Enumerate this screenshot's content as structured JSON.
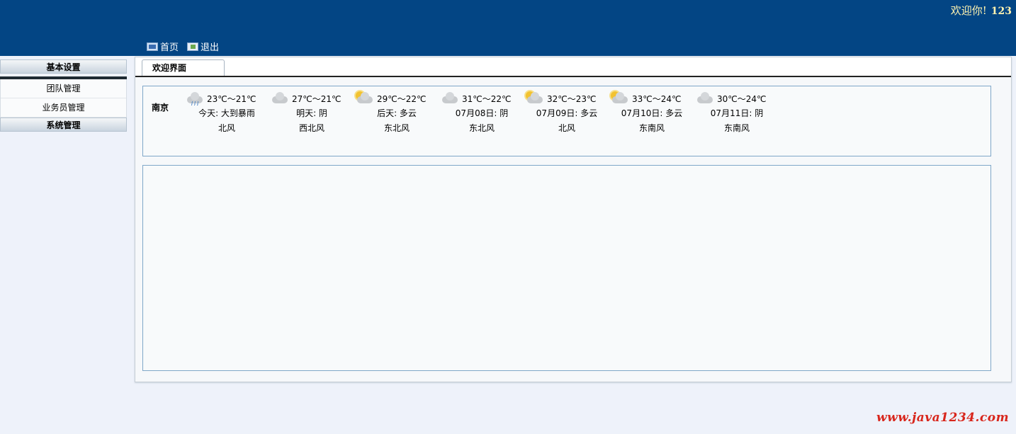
{
  "header": {
    "welcome_text": "欢迎你!",
    "username": "123",
    "nav": [
      {
        "label": "首页",
        "icon": "monitor-icon"
      },
      {
        "label": "退出",
        "icon": "logout-icon"
      }
    ]
  },
  "sidebar": {
    "sections": [
      {
        "title": "基本设置",
        "items": [
          "团队管理",
          "业务员管理"
        ]
      },
      {
        "title": "系统管理",
        "items": []
      }
    ]
  },
  "tabs": [
    {
      "label": "欢迎界面"
    }
  ],
  "weather": {
    "city": "南京",
    "days": [
      {
        "temp": "23℃～21℃",
        "desc": "今天: 大到暴雨",
        "wind": "北风",
        "icon": "rain-icon"
      },
      {
        "temp": "27℃～21℃",
        "desc": "明天: 阴",
        "wind": "西北风",
        "icon": "overcast-icon"
      },
      {
        "temp": "29℃～22℃",
        "desc": "后天: 多云",
        "wind": "东北风",
        "icon": "partly-cloudy-icon"
      },
      {
        "temp": "31℃～22℃",
        "desc": "07月08日: 阴",
        "wind": "东北风",
        "icon": "overcast-icon"
      },
      {
        "temp": "32℃～23℃",
        "desc": "07月09日: 多云",
        "wind": "北风",
        "icon": "partly-cloudy-icon"
      },
      {
        "temp": "33℃～24℃",
        "desc": "07月10日: 多云",
        "wind": "东南风",
        "icon": "partly-cloudy-icon"
      },
      {
        "temp": "30℃～24℃",
        "desc": "07月11日: 阴",
        "wind": "东南风",
        "icon": "overcast-icon"
      }
    ]
  },
  "watermark": "www.java1234.com",
  "colors": {
    "header_bg": "#034584",
    "welcome_text": "#fff3b0",
    "watermark": "#d8261c"
  }
}
